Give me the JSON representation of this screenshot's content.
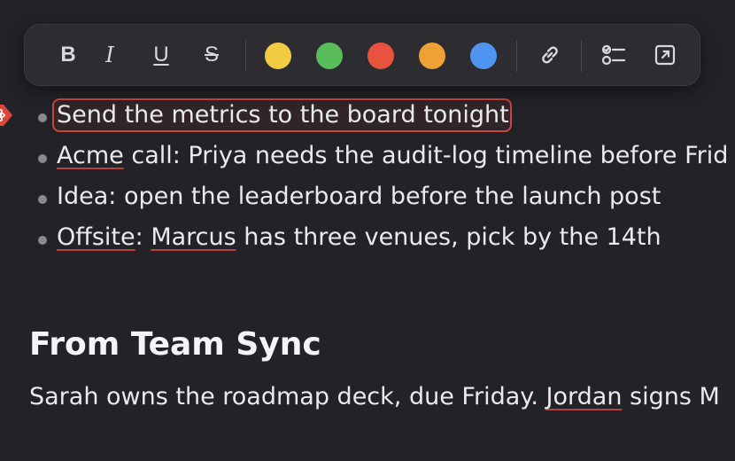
{
  "toolbar": {
    "buttons": [
      {
        "name": "bold",
        "label": "B"
      },
      {
        "name": "italic",
        "label": "I"
      },
      {
        "name": "underline",
        "label": "U"
      },
      {
        "name": "strikethrough",
        "label": "S"
      }
    ],
    "colors": [
      {
        "name": "yellow",
        "hex": "#f2cb45"
      },
      {
        "name": "green",
        "hex": "#59bd5c"
      },
      {
        "name": "red",
        "hex": "#e8523f"
      },
      {
        "name": "orange",
        "hex": "#f0a136"
      },
      {
        "name": "blue",
        "hex": "#4e95f2"
      }
    ],
    "icons": [
      "link-icon",
      "checklist-icon",
      "open-external-icon"
    ]
  },
  "bullets": [
    {
      "parts": [
        {
          "text": "Send the metrics to the board tonight",
          "spell": false
        }
      ],
      "highlighted": true
    },
    {
      "parts": [
        {
          "text": "Acme",
          "spell": true
        },
        {
          "text": " call: Priya needs the audit-log timeline before Frid",
          "spell": false
        }
      ],
      "highlighted": false
    },
    {
      "parts": [
        {
          "text": "Idea: open the leaderboard before the launch post",
          "spell": false
        }
      ],
      "highlighted": false
    },
    {
      "parts": [
        {
          "text": "Offsite",
          "spell": true
        },
        {
          "text": ": ",
          "spell": false
        },
        {
          "text": "Marcus",
          "spell": true
        },
        {
          "text": " has three venues, pick by the 14th",
          "spell": false
        }
      ],
      "highlighted": false
    }
  ],
  "section": {
    "heading": "From Team Sync",
    "paragraph_parts": [
      {
        "text": "Sarah owns the roadmap deck, due Friday. ",
        "spell": false
      },
      {
        "text": "Jordan",
        "spell": true
      },
      {
        "text": " signs M",
        "spell": false
      }
    ]
  },
  "colors": {
    "background": "#232226",
    "highlight_border": "#c8473f",
    "spellcheck_underline": "#b5423e",
    "marker": "#e0453a"
  }
}
